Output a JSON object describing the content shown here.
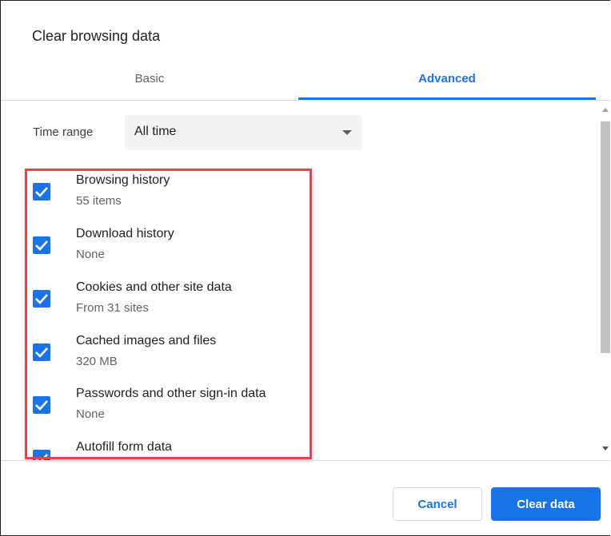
{
  "dialog": {
    "title": "Clear browsing data"
  },
  "tabs": [
    {
      "label": "Basic",
      "selected": false
    },
    {
      "label": "Advanced",
      "selected": true
    }
  ],
  "time_range": {
    "label": "Time range",
    "value": "All time"
  },
  "items": [
    {
      "title": "Browsing history",
      "subtitle": "55 items",
      "checked": true
    },
    {
      "title": "Download history",
      "subtitle": "None",
      "checked": true
    },
    {
      "title": "Cookies and other site data",
      "subtitle": "From 31 sites",
      "checked": true
    },
    {
      "title": "Cached images and files",
      "subtitle": "320 MB",
      "checked": true
    },
    {
      "title": "Passwords and other sign-in data",
      "subtitle": "None",
      "checked": true
    },
    {
      "title": "Autofill form data",
      "subtitle": "",
      "checked": true
    }
  ],
  "buttons": {
    "cancel": "Cancel",
    "clear": "Clear data"
  },
  "colors": {
    "accent": "#1a73e8",
    "highlight_border": "#e5434a"
  },
  "icons": {
    "checkbox": "checkmark-icon",
    "dropdown": "dropdown-arrow-icon"
  }
}
